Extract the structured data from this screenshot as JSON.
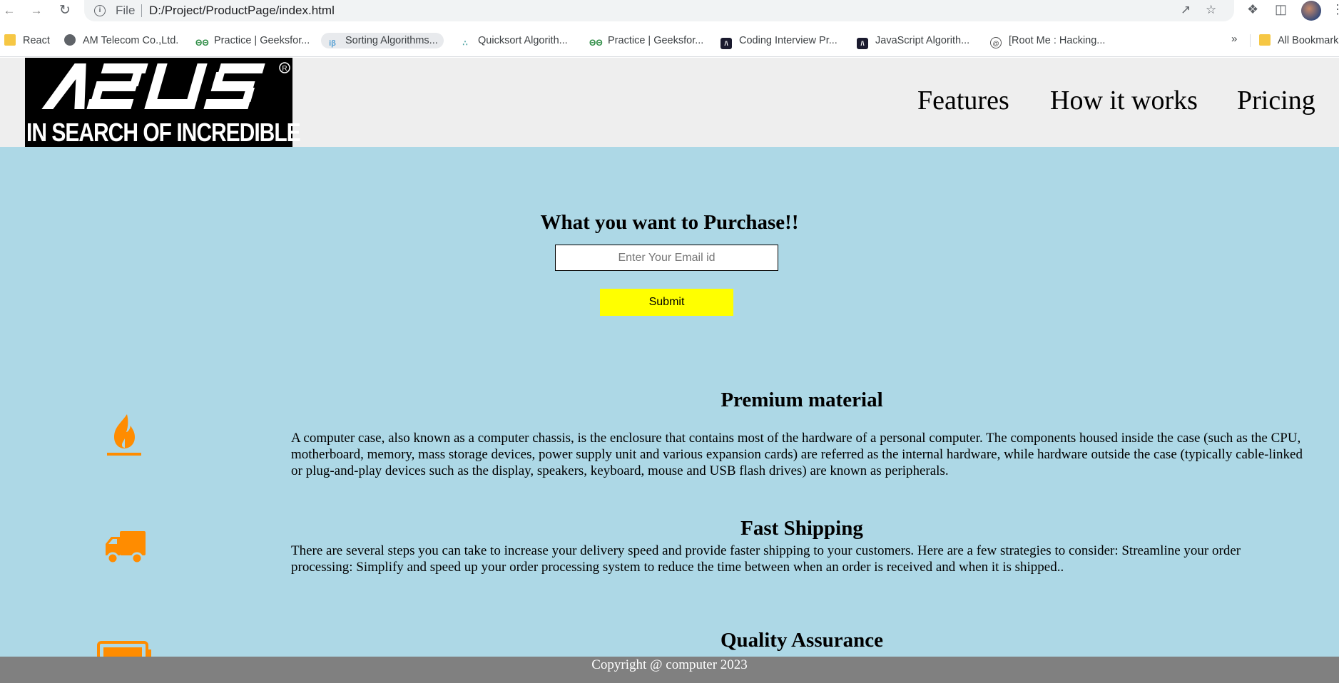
{
  "browser": {
    "address": {
      "scheme_label": "File",
      "url": "D:/Project/ProductPage/index.html"
    },
    "bookmarks": [
      {
        "label": "React",
        "icon": "folder-icon"
      },
      {
        "label": "AM Telecom Co.,Ltd.",
        "icon": "globe-icon"
      },
      {
        "label": "Practice | Geeksfor...",
        "icon": "geeksforgeeks-icon"
      },
      {
        "label": "Sorting Algorithms...",
        "icon": "ib-icon"
      },
      {
        "label": "Quicksort Algorith...",
        "icon": "sort-icon"
      },
      {
        "label": "Practice | Geeksfor...",
        "icon": "geeksforgeeks-icon"
      },
      {
        "label": "Coding Interview Pr...",
        "icon": "codinginterview-icon"
      },
      {
        "label": "JavaScript Algorith...",
        "icon": "codinginterview-icon"
      },
      {
        "label": "[Root Me : Hacking...",
        "icon": "rootme-icon"
      }
    ],
    "overflow_label": "»",
    "all_bookmarks_label": "All Bookmarks"
  },
  "header": {
    "logo": {
      "brand": "ASUS",
      "tagline": "IN SEARCH OF INCREDIBLE"
    },
    "nav": [
      "Features",
      "How it works",
      "Pricing"
    ]
  },
  "hero": {
    "title": "What you want to Purchase!!",
    "email_placeholder": "Enter Your Email id",
    "submit_label": "Submit"
  },
  "features": [
    {
      "icon": "fire-icon",
      "title": "Premium material",
      "description": "A computer case, also known as a computer chassis, is the enclosure that contains most of the hardware of a personal computer. The components housed inside the case (such as the CPU, motherboard, memory, mass storage devices, power supply unit and various expansion cards) are referred as the internal hardware, while hardware outside the case (typically cable-linked or plug-and-play devices such as the display, speakers, keyboard, mouse and USB flash drives) are known as peripherals."
    },
    {
      "icon": "truck-icon",
      "title": "Fast Shipping",
      "description": "There are several steps you can take to increase your delivery speed and provide faster shipping to your customers. Here are a few strategies to consider: Streamline your order processing: Simplify and speed up your order processing system to reduce the time between when an order is received and when it is shipped.."
    },
    {
      "icon": "battery-icon",
      "title": "Quality Assurance",
      "description": ""
    }
  ],
  "footer": {
    "text": "Copyright @ computer 2023"
  },
  "colors": {
    "page_bg": "#add8e6",
    "header_bg": "#eeeeee",
    "icon_orange": "#ff8c00",
    "submit_bg": "#ffff00",
    "footer_bg": "#808080"
  }
}
